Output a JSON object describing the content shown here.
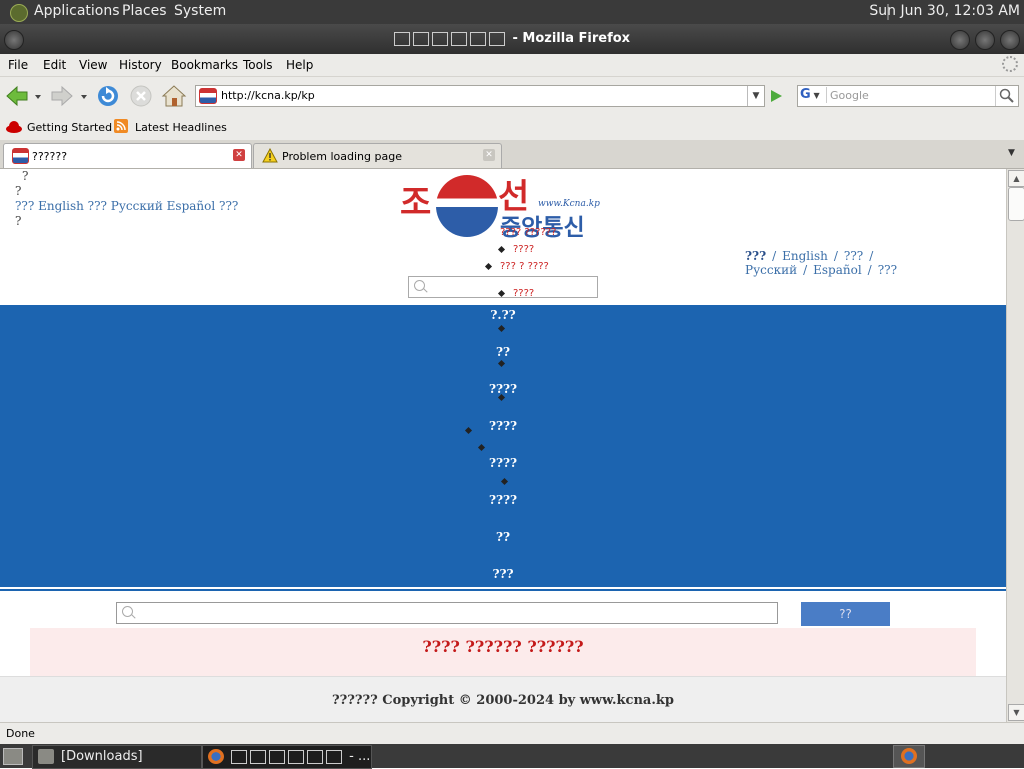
{
  "top_panel": {
    "applications": "Applications",
    "places": "Places",
    "system": "System",
    "clock": "Sun Jun 30, 12:03 AM"
  },
  "window": {
    "title_suffix": " - Mozilla Firefox"
  },
  "menubar": {
    "file": "File",
    "edit": "Edit",
    "view": "View",
    "history": "History",
    "bookmarks": "Bookmarks",
    "tools": "Tools",
    "help": "Help"
  },
  "navbar": {
    "url": "http://kcna.kp/kp",
    "search_engine": "G",
    "search_placeholder": "Google"
  },
  "bookmarks_bar": {
    "getting_started": "Getting Started",
    "latest_headlines": "Latest Headlines"
  },
  "tabs": [
    {
      "label": "??????",
      "active": true
    },
    {
      "label": "Problem loading page",
      "active": false
    }
  ],
  "page": {
    "left_links": {
      "q1": "?",
      "q2": "?",
      "line": "??? English ??? Русский Español ???",
      "q3": "?"
    },
    "logo": {
      "jo": "조",
      "seon": "선",
      "bottom": "중앙통신",
      "url": "www.Kcna.kp"
    },
    "lang_right": {
      "current": "???",
      "english": "English",
      "chinese": "???",
      "russian": "Русский",
      "spanish": "Español",
      "japanese": "???"
    },
    "dropdown": {
      "i1": "???? ??????",
      "i2": "????",
      "i3": "??? ? ????",
      "i4": "????"
    },
    "nav": [
      "?.??",
      "??",
      "????",
      "????",
      "????",
      "????",
      "??",
      "???"
    ],
    "search_button": "??",
    "headline": "???? ?????? ??????",
    "copyright": "?????? Copyright © 2000-2024 by www.kcna.kp"
  },
  "statusbar": {
    "text": "Done"
  },
  "taskbar": {
    "downloads": "[Downloads]",
    "firefox_suffix": " - ..."
  },
  "colors": {
    "band_blue": "#1c64b0",
    "headline_red": "#c41a1a",
    "link_blue": "#3a6ea8"
  }
}
